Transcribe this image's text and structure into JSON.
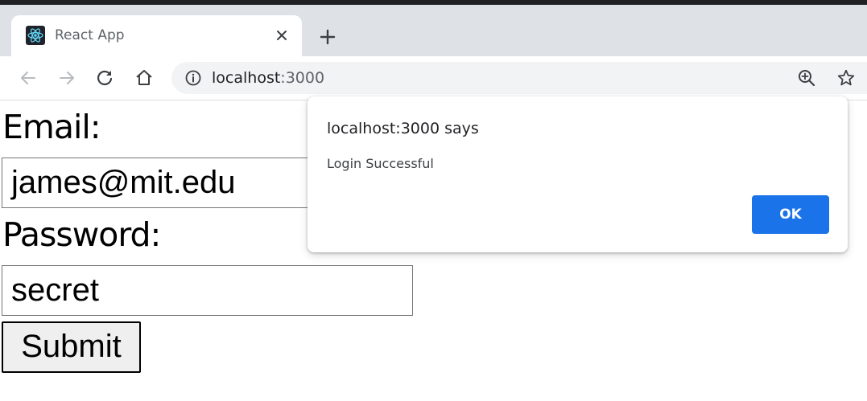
{
  "browser": {
    "tab": {
      "title": "React App",
      "favicon_icon": "react-logo-icon",
      "close_icon": "close-icon"
    },
    "new_tab_icon": "plus-icon",
    "nav": {
      "back_icon": "arrow-left-icon",
      "forward_icon": "arrow-right-icon",
      "reload_icon": "reload-icon",
      "home_icon": "home-icon"
    },
    "omnibox": {
      "host": "localhost",
      "port": ":3000",
      "info_icon": "info-icon",
      "zoom_icon": "zoom-in-icon",
      "bookmark_icon": "star-icon"
    }
  },
  "form": {
    "email_label": "Email:",
    "email_value": "james@mit.edu",
    "password_label": "Password:",
    "password_value": "secret",
    "submit_label": "Submit"
  },
  "alert": {
    "title": "localhost:3000 says",
    "message": "Login Successful",
    "ok_label": "OK"
  },
  "colors": {
    "tabstrip": "#dee1e6",
    "omnibox": "#f1f3f4",
    "ok_button": "#1a73e8"
  }
}
